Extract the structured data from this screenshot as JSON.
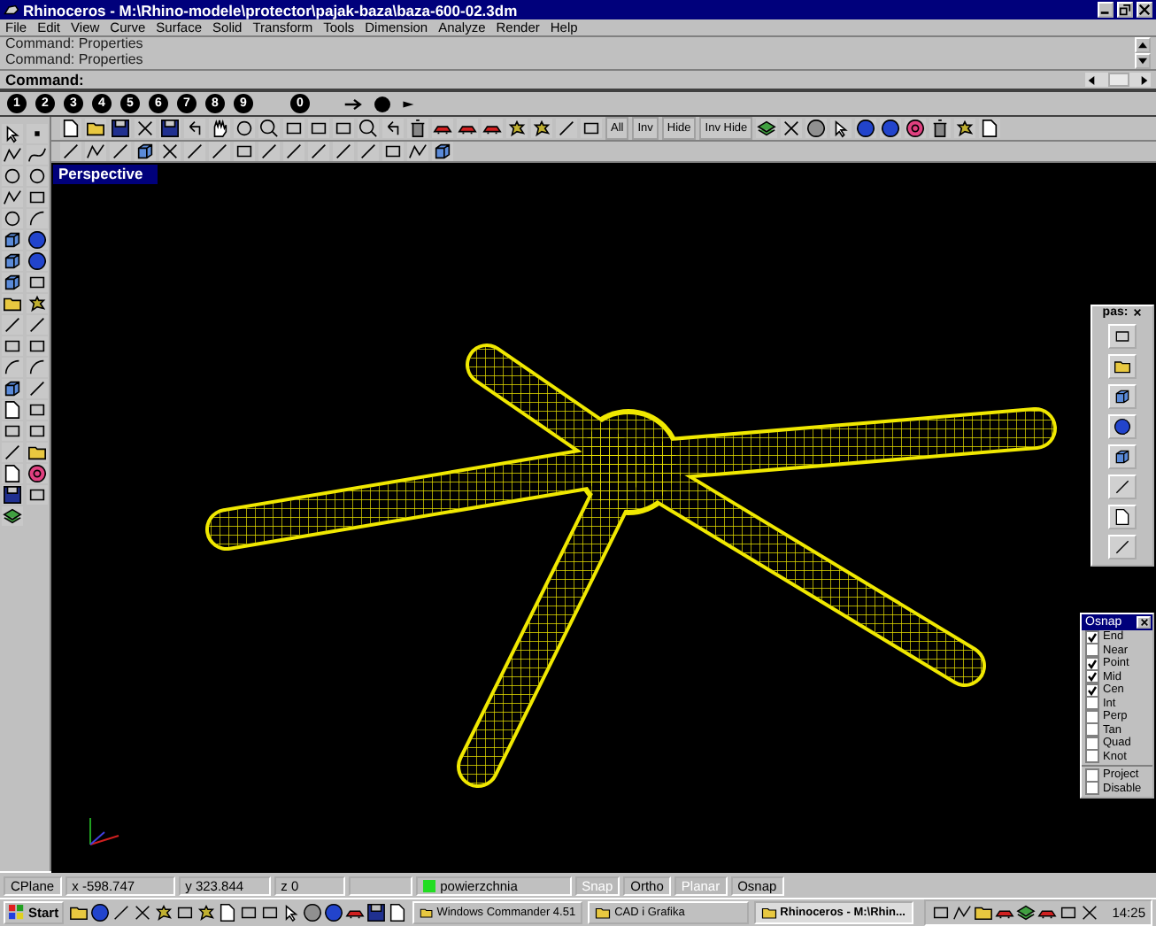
{
  "window": {
    "title": "Rhinoceros - M:\\Rhino-modele\\protector\\pajak-baza\\baza-600-02.3dm"
  },
  "menu": [
    "File",
    "Edit",
    "View",
    "Curve",
    "Surface",
    "Solid",
    "Transform",
    "Tools",
    "Dimension",
    "Analyze",
    "Render",
    "Help"
  ],
  "command_history": [
    "Command: Properties",
    "Command: Properties"
  ],
  "command_prompt": "Command:",
  "number_toolbar": [
    "1",
    "2",
    "3",
    "4",
    "5",
    "6",
    "7",
    "8",
    "9",
    "0"
  ],
  "view_toolbar": {
    "text_buttons": [
      "All",
      "Inv",
      "Hide",
      "Inv Hide"
    ]
  },
  "viewport": {
    "title": "Perspective"
  },
  "floating_toolbar": {
    "title": "pas:"
  },
  "osnap": {
    "title": "Osnap",
    "items": [
      {
        "label": "End",
        "checked": true
      },
      {
        "label": "Near",
        "checked": false
      },
      {
        "label": "Point",
        "checked": true
      },
      {
        "label": "Mid",
        "checked": true
      },
      {
        "label": "Cen",
        "checked": true
      },
      {
        "label": "Int",
        "checked": false
      },
      {
        "label": "Perp",
        "checked": false
      },
      {
        "label": "Tan",
        "checked": false
      },
      {
        "label": "Quad",
        "checked": false
      },
      {
        "label": "Knot",
        "checked": false
      }
    ],
    "options": [
      {
        "label": "Project",
        "checked": false
      },
      {
        "label": "Disable",
        "checked": false
      }
    ]
  },
  "status_bar": {
    "cplane": "CPlane",
    "x": "x -598.747",
    "y": "y 323.844",
    "z": "z 0",
    "layer": {
      "name": "powierzchnia",
      "color": "#22dd22"
    },
    "toggles": [
      {
        "label": "Snap",
        "on": false
      },
      {
        "label": "Ortho",
        "on": true
      },
      {
        "label": "Planar",
        "on": false
      },
      {
        "label": "Osnap",
        "on": true
      }
    ]
  },
  "taskbar": {
    "start": "Start",
    "tasks": [
      {
        "label": "Windows Commander 4.51",
        "selected": false
      },
      {
        "label": "CAD i Grafika",
        "selected": false
      },
      {
        "label": "Rhinoceros - M:\\Rhin...",
        "selected": true
      }
    ],
    "clock": "14:25"
  }
}
